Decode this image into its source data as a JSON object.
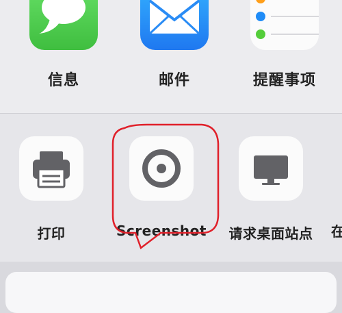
{
  "share_sheet": {
    "apps": [
      {
        "label": "信息",
        "icon": "messages-icon",
        "color": "#4cd14c"
      },
      {
        "label": "邮件",
        "icon": "mail-icon",
        "color": "#1f8cf7"
      },
      {
        "label": "提醒事项",
        "icon": "reminders-icon",
        "color": "#ffffff"
      }
    ],
    "actions": [
      {
        "label": "打印",
        "icon": "printer-icon"
      },
      {
        "label": "Screenshot",
        "icon": "screenshot-icon"
      },
      {
        "label": "请求桌面站点",
        "icon": "desktop-icon"
      }
    ],
    "clipped_next_label": "在"
  },
  "annotation": {
    "color": "#e0202a"
  }
}
